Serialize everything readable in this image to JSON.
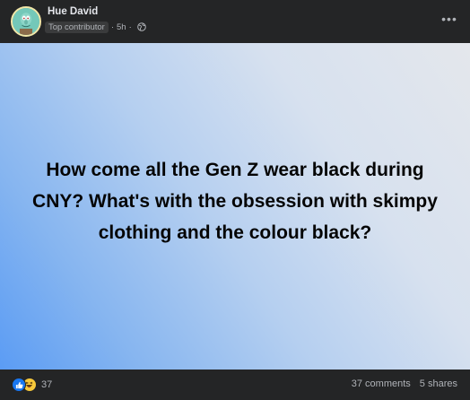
{
  "post": {
    "author": "Hue David",
    "badge": "Top contributor",
    "separator": "·",
    "time": "5h",
    "privacy_icon": "globe-icon",
    "more_icon": "more-horizontal-icon",
    "text": "How come all the Gen Z wear black during CNY? What's with the obsession with skimpy clothing and the colour black?",
    "background_colors": [
      "#5b9cf4",
      "#e4e7ec"
    ]
  },
  "footer": {
    "reaction_icons": [
      "like-icon",
      "haha-icon"
    ],
    "reaction_count": "37",
    "comments": "37 comments",
    "shares": "5 shares"
  }
}
